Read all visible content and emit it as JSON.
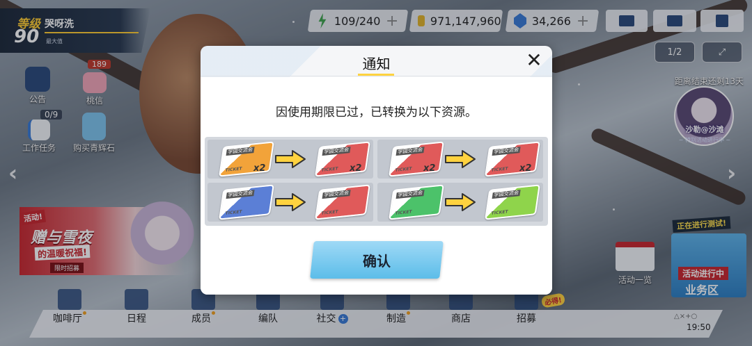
{
  "player": {
    "level_label": "等级",
    "level": "90",
    "name": "哭呀洗",
    "title": "最大值"
  },
  "resources": [
    {
      "value": "109/240",
      "icon": "energy-icon",
      "color": "#3fa34d"
    },
    {
      "value": "971,147,960",
      "icon": "credit-icon",
      "color": "#e0b22a"
    },
    {
      "value": "34,266",
      "icon": "crystal-icon",
      "color": "#3a7bd5"
    }
  ],
  "left_menu": {
    "announcement": "公告",
    "mail_count": "189",
    "mail": "桃信",
    "tasks_progress": "0/9",
    "tasks": "工作任务",
    "buy_stones": "购买青辉石"
  },
  "event_banner": {
    "tag": "活动!",
    "title": "赠与雪夜",
    "subtitle": "的温暖祝福!",
    "limited": "限时招募"
  },
  "right_panel": {
    "page_toggle": "1/2",
    "countdown": "距离结束还剩13天",
    "test_caption": "沙勒@沙滩",
    "test_caption2": "~ 特别活动进行中 ~",
    "in_progress": "正在进行测试!",
    "biz_tag": "活动进行中",
    "biz_title": "业务区",
    "activity_list": "活动一览"
  },
  "bottom_nav": [
    {
      "label": "咖啡厅",
      "icon": "cafe-icon",
      "dot": true
    },
    {
      "label": "日程",
      "icon": "schedule-icon",
      "dot": false
    },
    {
      "label": "成员",
      "icon": "students-icon",
      "dot": true
    },
    {
      "label": "编队",
      "icon": "formation-icon",
      "dot": false
    },
    {
      "label": "社交",
      "icon": "social-icon",
      "dot": false,
      "plus": true
    },
    {
      "label": "制造",
      "icon": "craft-icon",
      "dot": true
    },
    {
      "label": "商店",
      "icon": "shop-icon",
      "dot": false
    },
    {
      "label": "招募",
      "icon": "recruit-icon",
      "dot": false
    }
  ],
  "must_tag": "必得!",
  "clock": "19:50",
  "signal": "△×+○",
  "modal": {
    "title": "通知",
    "close": "✕",
    "message": "因使用期限已过，已转换为以下资源。",
    "conversions": [
      {
        "from_color": "#f2a33a",
        "to_color": "#e05a5a",
        "from_qty": "x2",
        "to_qty": "x2"
      },
      {
        "from_color": "#e05a5a",
        "to_color": "#e05a5a",
        "from_qty": "x2",
        "to_qty": "x2"
      },
      {
        "from_color": "#5b7fd6",
        "to_color": "#e05a5a",
        "from_qty": "",
        "to_qty": ""
      },
      {
        "from_color": "#4cc26a",
        "to_color": "#8fd44b",
        "from_qty": "",
        "to_qty": ""
      }
    ],
    "ticket_label": "学园交流会",
    "ticket_word": "TICKET",
    "confirm": "确认"
  }
}
